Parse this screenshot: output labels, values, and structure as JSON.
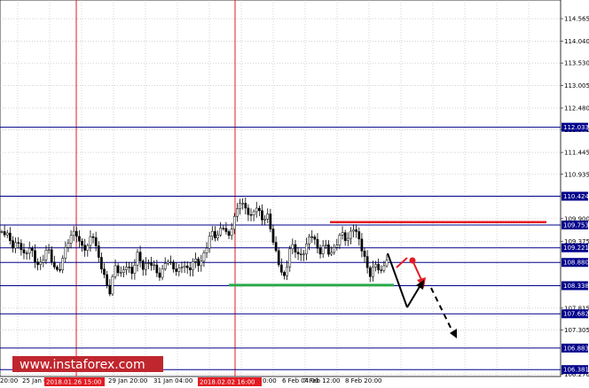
{
  "chart_data": {
    "type": "candlestick",
    "y_axis": {
      "range": [
        106.22,
        115.0
      ],
      "ticks": [
        "114.565",
        "114.040",
        "113.530",
        "113.005",
        "112.480",
        "111.970",
        "111.445",
        "110.935",
        "109.900",
        "109.375",
        "107.815",
        "107.305",
        "106.270"
      ]
    },
    "x_axis": {
      "ticks": [
        "20:00",
        "25 Jan 04:00",
        "29 Jan 20:00",
        "31 Jan 04:00",
        "6 Feb 04:00",
        "7 Feb 12:00",
        "8 Feb 20:00"
      ],
      "highlighted": [
        "2018.01.26 15:00",
        "2018.02.02 16:00"
      ],
      "partial_label": "0:00"
    },
    "levels": [
      {
        "value": 112.033,
        "label": "112.033",
        "color": "#00008b"
      },
      {
        "value": 110.424,
        "label": "110.424",
        "color": "#00008b"
      },
      {
        "value": 109.753,
        "label": "109.753",
        "color": "#00008b"
      },
      {
        "value": 109.221,
        "label": "109.221",
        "color": "#00008b"
      },
      {
        "value": 108.88,
        "label": "108.880",
        "color": "#00008b"
      },
      {
        "value": 108.338,
        "label": "108.338",
        "color": "#00008b"
      },
      {
        "value": 107.682,
        "label": "107.682",
        "color": "#00008b"
      },
      {
        "value": 106.883,
        "label": "106.883",
        "color": "#00008b"
      },
      {
        "value": 106.381,
        "label": "106.381",
        "color": "#00008b"
      }
    ],
    "price_path": [
      109.6,
      109.45,
      109.15,
      109.3,
      109.05,
      109.35,
      108.95,
      108.85,
      109.2,
      108.75,
      108.55,
      109.1,
      109.55,
      109.7,
      109.3,
      109.15,
      109.5,
      108.95,
      108.6,
      108.2,
      108.9,
      108.65,
      108.8,
      108.55,
      109.0,
      108.7,
      108.95,
      108.85,
      108.6,
      108.95,
      108.75,
      108.55,
      108.8,
      108.7,
      109.05,
      108.9,
      109.2,
      109.55,
      109.35,
      109.7,
      109.45,
      109.95,
      110.4,
      110.2,
      109.9,
      110.1,
      109.8,
      109.95,
      109.4,
      108.9,
      108.55,
      109.3,
      109.05,
      108.9,
      109.35,
      109.6,
      109.15,
      109.4,
      109.05,
      109.2,
      109.5,
      109.3,
      109.75,
      109.55,
      109.1,
      108.6,
      108.8,
      108.55,
      108.9
    ],
    "resistance_line": 109.82,
    "support_line": 108.35,
    "red_vlines": [
      "2018.01.26 15:00",
      "2018.02.02 16:00"
    ],
    "colors": {
      "accent_red": "#e31b23",
      "support_green": "#2aa84a",
      "level_blue": "#00008b",
      "watermark": "#c0262e"
    }
  },
  "watermark": "www.instaforex.com"
}
